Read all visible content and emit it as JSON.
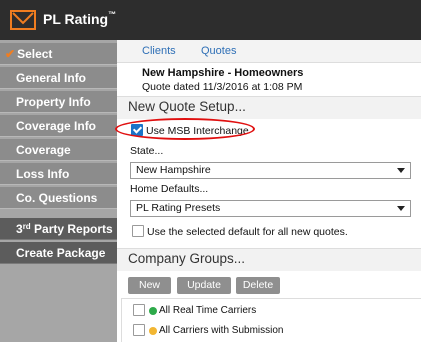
{
  "app": {
    "title": "PL Rating",
    "trademark": "™"
  },
  "sidebar": {
    "items": [
      {
        "label": "Select Companies"
      },
      {
        "label": "General Info"
      },
      {
        "label": "Property Info"
      },
      {
        "label": "Coverage Info"
      },
      {
        "label": "Coverage Options"
      },
      {
        "label": "Loss Info"
      },
      {
        "label": "Co. Questions"
      }
    ],
    "third_party": {
      "prefix": "3",
      "sup": "rd",
      "suffix": " Party Reports"
    },
    "create_package": "Create Package"
  },
  "tabs": {
    "clients": "Clients",
    "quotes": "Quotes"
  },
  "quote": {
    "title": "New Hampshire - Homeowners",
    "date": "Quote dated 11/3/2016 at 1:08 PM"
  },
  "setup": {
    "title": "New Quote Setup...",
    "msb_label": "Use MSB Interchange",
    "msb_checked": true,
    "state_label": "State...",
    "state_value": "New Hampshire",
    "defaults_label": "Home Defaults...",
    "defaults_value": "PL Rating Presets",
    "use_default_label": "Use the selected default for all new quotes.",
    "use_default_checked": false
  },
  "groups": {
    "title": "Company Groups...",
    "buttons": {
      "new": "New",
      "update": "Update",
      "delete": "Delete"
    },
    "items": [
      {
        "label": "All Real Time Carriers",
        "dot_color": "#2eaa4a"
      },
      {
        "label": "All Carriers with Submission",
        "dot_color": "#f2b632"
      }
    ]
  },
  "colors": {
    "accent": "#f07d20",
    "link": "#2e6fb6",
    "highlight": "#e01010"
  }
}
